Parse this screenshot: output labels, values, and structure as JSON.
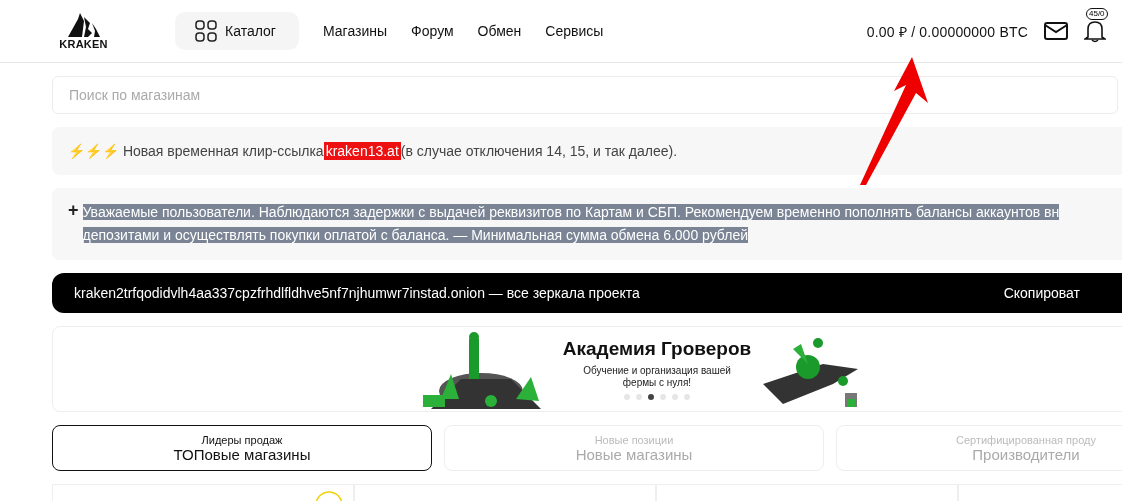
{
  "header": {
    "logo": "KRAKEN",
    "catalog": "Каталог",
    "nav": [
      "Магазины",
      "Форум",
      "Обмен",
      "Сервисы"
    ],
    "balance": "0.00 ₽ / 0.00000000 BTC",
    "notifications": "45/0"
  },
  "search": {
    "placeholder": "Поиск по магазинам"
  },
  "notice": {
    "icon": "⚡⚡⚡",
    "before": "Новая временная клир-ссылка",
    "link": "kraken13.at",
    "after": "(в случае отключения 14, 15, и так далее)."
  },
  "announcement": {
    "icon": "+",
    "selected": true,
    "lines": [
      "Уважаемые пользователи. Наблюдаются задержки с выдачей реквизитов по Картам и СБП. Рекомендуем временно пополнять балансы аккаунтов вн",
      "депозитами и осуществлять покупки оплатой с баланса. — Минимальная сумма обмена 6.000 рублей"
    ]
  },
  "mirror_bar": {
    "text": "kraken2trfqodidvlh4aa337cpzfrhdlfldhve5nf7njhumwr7instad.onion — все зеркала проекта",
    "action": "Скопироват"
  },
  "banner": {
    "title": "Академия Гроверов",
    "subtitle": "Обучение и организация вашей фермы с нуля!",
    "dots": [
      {
        "selected": false
      },
      {
        "selected": false
      },
      {
        "selected": true
      },
      {
        "selected": false
      },
      {
        "selected": false
      },
      {
        "selected": false
      }
    ]
  },
  "tabs": [
    {
      "caption": "Лидеры продаж",
      "label": "ТОПовые магазины",
      "selected": true
    },
    {
      "caption": "Новые позиции",
      "label": "Новые магазины",
      "selected": false
    },
    {
      "caption": "Сертифицированная проду",
      "label": "Производители",
      "selected": false
    }
  ],
  "annotation": {
    "kind": "arrow"
  }
}
